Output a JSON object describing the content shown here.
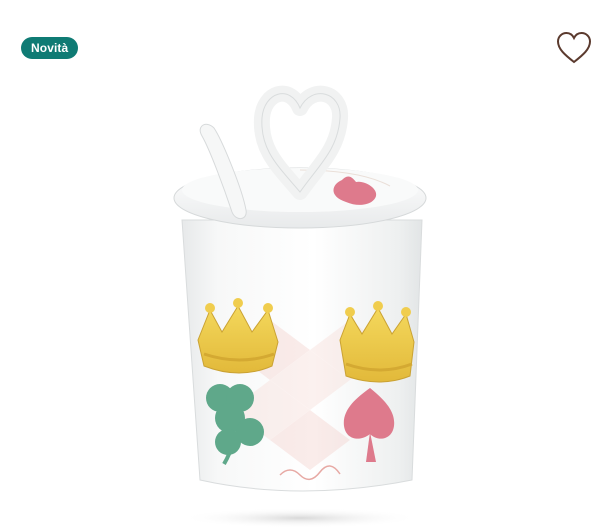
{
  "badge": {
    "label": "Novità",
    "color": "#0f7b74"
  },
  "wishlist": {
    "icon": "heart-outline-icon",
    "color": "#5b3a2e"
  },
  "product": {
    "image_name": "sugar-bowl-with-spoon",
    "motifs": [
      "crown",
      "clover",
      "spade-heart"
    ]
  }
}
